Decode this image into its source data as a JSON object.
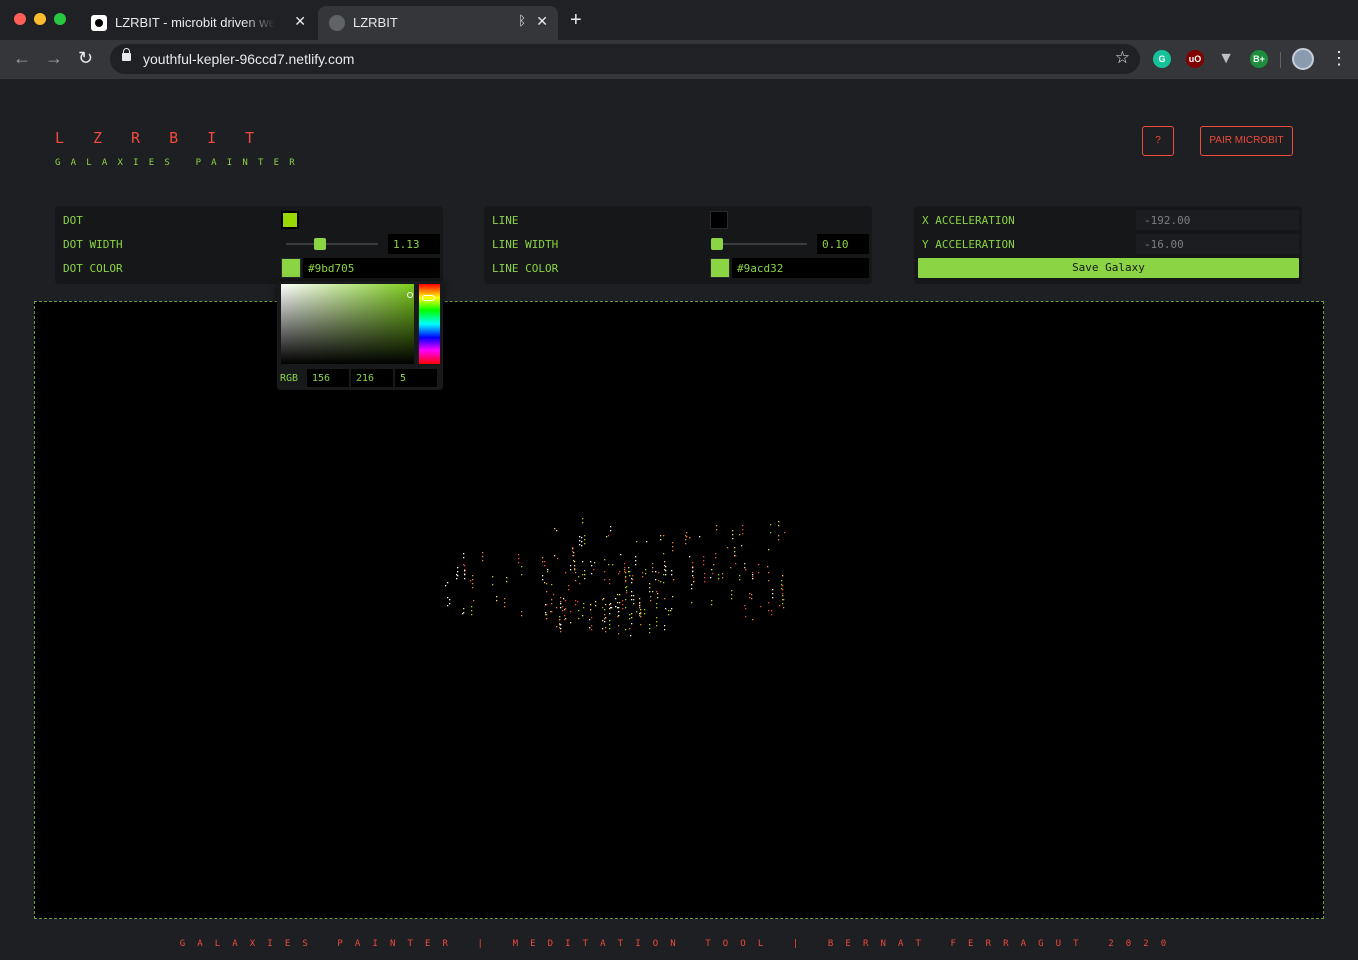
{
  "browser": {
    "tabs": [
      {
        "title": "LZRBIT - microbit driven web a"
      },
      {
        "title": "LZRBIT"
      }
    ],
    "url": "youthful-kepler-96ccd7.netlify.com",
    "extensions": [
      "grammarly-icon",
      "ublock-icon",
      "vue-devtools-icon",
      "bplus-icon"
    ]
  },
  "app": {
    "logo": "LZRBIT",
    "subtitle": "GALAXIES PAINTER",
    "help_label": "?",
    "pair_label": "PAIR MICROBIT"
  },
  "dot_panel": {
    "dot_label": "DOT",
    "dot_enabled": true,
    "width_label": "DOT WIDTH",
    "width_value": "1.13",
    "color_label": "DOT COLOR",
    "color_hex": "#9bd705"
  },
  "line_panel": {
    "line_label": "LINE",
    "line_enabled": false,
    "width_label": "LINE WIDTH",
    "width_value": "0.10",
    "color_label": "LINE COLOR",
    "color_hex": "#9acd32"
  },
  "accel_panel": {
    "x_label": "X ACCELERATION",
    "x_value": "-192.00",
    "y_label": "Y ACCELERATION",
    "y_value": "-16.00",
    "save_label": "Save Galaxy"
  },
  "color_picker": {
    "mode_label": "RGB",
    "r": "156",
    "g": "216",
    "b": "5"
  },
  "footer": "GALAXIES PAINTER | MEDITATION TOOL | BERNAT FERRAGUT 2020",
  "colors": {
    "accent_red": "#ef4a3c",
    "accent_green": "#8bd444",
    "canvas_border": "#6f9f34",
    "dots": [
      "#ef4a3c",
      "#f5d76e",
      "#ffffff",
      "#9bd705",
      "#e8843c"
    ]
  }
}
